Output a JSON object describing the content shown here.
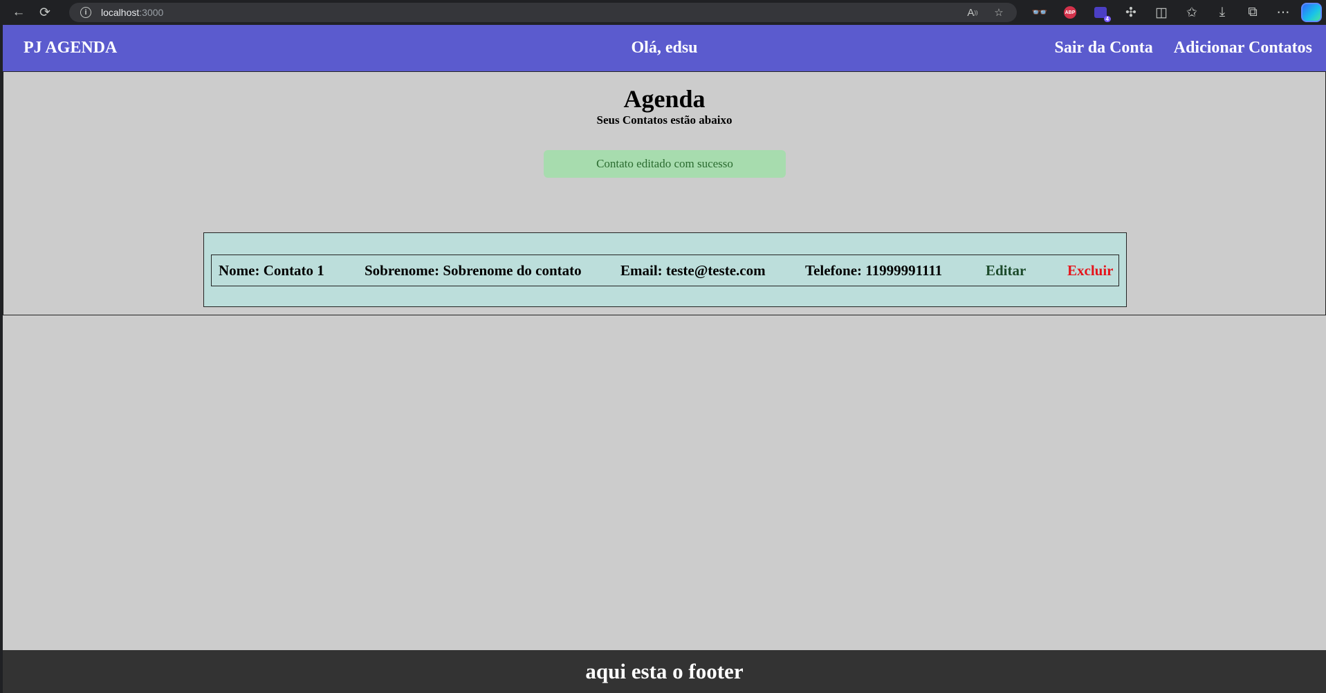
{
  "browser": {
    "url_host": "localhost",
    "url_port": ":3000",
    "info_glyph": "i",
    "abp_label": "ABP",
    "ext_badge": "4"
  },
  "header": {
    "brand": "PJ AGENDA",
    "greeting": "Olá, edsu",
    "logout_link": "Sair da Conta",
    "add_contacts_link": "Adicionar Contatos"
  },
  "main": {
    "title": "Agenda",
    "subtitle": "Seus Contatos estão abaixo",
    "alert_message": "Contato editado com sucesso"
  },
  "contacts": [
    {
      "nome": "Nome: Contato 1",
      "sobrenome": "Sobrenome: Sobrenome do contato",
      "email": "Email: teste@teste.com",
      "telefone": "Telefone: 11999991111",
      "edit_label": "Editar",
      "delete_label": "Excluir"
    }
  ],
  "footer": {
    "text": "aqui esta o footer"
  },
  "colors": {
    "header_bg": "#5b5bce",
    "page_bg": "#cccccc",
    "card_bg": "#bcdedb",
    "alert_bg": "#a7dcae",
    "alert_text": "#2a6b2f",
    "edit_link": "#1c4a2b",
    "delete_link": "#e5151c",
    "footer_bg": "#333333"
  }
}
